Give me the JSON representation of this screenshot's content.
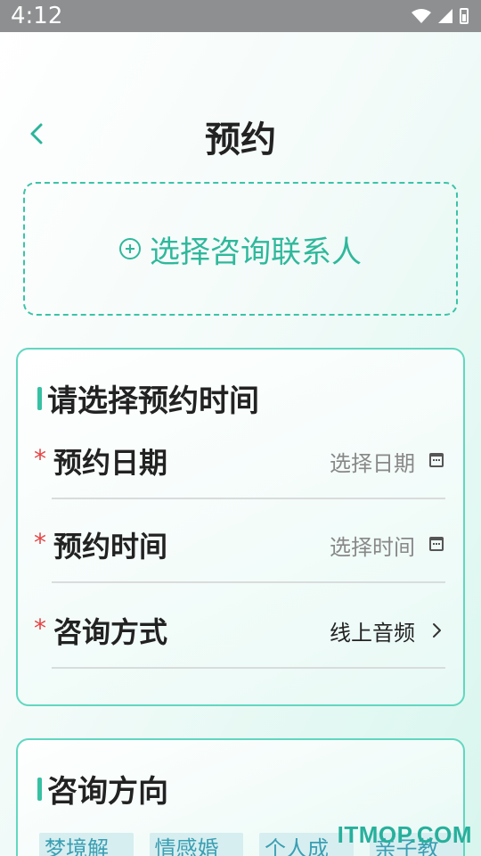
{
  "status_bar": {
    "time": "4:12"
  },
  "header": {
    "title": "预约"
  },
  "contact": {
    "label": "选择咨询联系人"
  },
  "time_section": {
    "title": "请选择预约时间",
    "rows": [
      {
        "required": "*",
        "label": "预约日期",
        "value": "选择日期",
        "icon": "calendar-icon"
      },
      {
        "required": "*",
        "label": "预约时间",
        "value": "选择时间",
        "icon": "calendar-icon"
      },
      {
        "required": "*",
        "label": "咨询方式",
        "value": "线上音频",
        "icon": "chevron-right-icon"
      }
    ]
  },
  "direction_section": {
    "title": "咨询方向",
    "tags": [
      "梦境解析",
      "情感婚姻",
      "个人成长",
      "亲子教育"
    ]
  },
  "watermark": "ITMOP.COM",
  "colors": {
    "accent": "#2fb89b",
    "required": "#e64545",
    "tag_bg": "#d7eef0"
  }
}
